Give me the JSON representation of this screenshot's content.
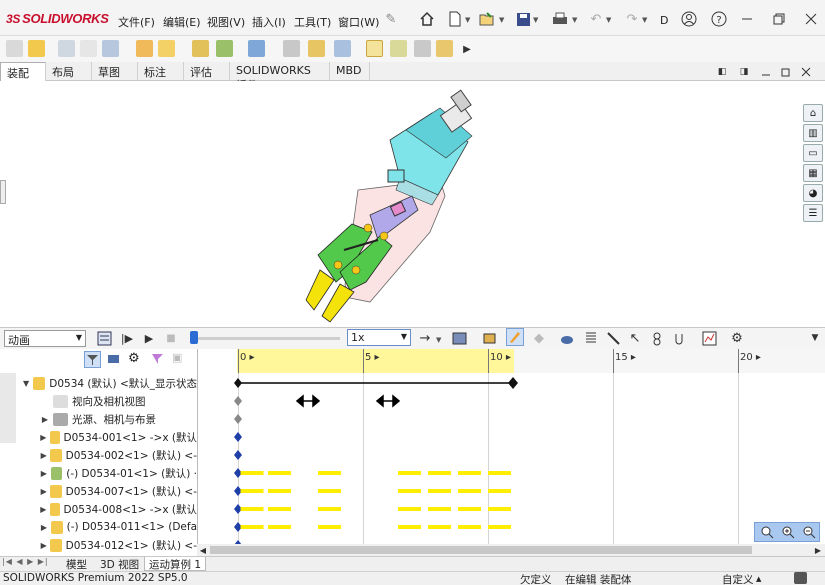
{
  "app": {
    "logo": "SOLIDWORKS",
    "logo_prefix": "3S"
  },
  "menu": [
    "文件(F)",
    "编辑(E)",
    "视图(V)",
    "插入(I)",
    "工具(T)",
    "窗口(W)"
  ],
  "right_caret": "D",
  "tabs": [
    "装配体",
    "布局",
    "草图",
    "标注",
    "评估",
    "SOLIDWORKS 插件",
    "MBD"
  ],
  "motion": {
    "study_type": "动画",
    "speed": "1x"
  },
  "ruler": [
    {
      "label": "0",
      "t": 0
    },
    {
      "label": "5",
      "t": 5
    },
    {
      "label": "10",
      "t": 10
    },
    {
      "label": "15",
      "t": 15
    },
    {
      "label": "20",
      "t": 20
    }
  ],
  "tree": [
    {
      "label": "D0534 (默认) <默认_显示状态",
      "expand": "▼",
      "level": 0,
      "icon": "asm"
    },
    {
      "label": "视向及相机视图",
      "expand": "",
      "level": 1,
      "icon": "cam"
    },
    {
      "label": "光源、相机与布景",
      "expand": "▶",
      "level": 1,
      "icon": "light"
    },
    {
      "label": "D0534-001<1> ->x (默认",
      "expand": "▶",
      "level": 1,
      "icon": "part"
    },
    {
      "label": "D0534-002<1> (默认) <-",
      "expand": "▶",
      "level": 1,
      "icon": "part"
    },
    {
      "label": "(-) D0534-01<1> (默认) ·",
      "expand": "▶",
      "level": 1,
      "icon": "part2"
    },
    {
      "label": "D0534-007<1> (默认) <-",
      "expand": "▶",
      "level": 1,
      "icon": "part"
    },
    {
      "label": "D0534-008<1> ->x (默认",
      "expand": "▶",
      "level": 1,
      "icon": "part"
    },
    {
      "label": "(-) D0534-011<1> (Defa",
      "expand": "▶",
      "level": 1,
      "icon": "part"
    },
    {
      "label": "D0534-012<1> (默认) <-",
      "expand": "▶",
      "level": 1,
      "icon": "part"
    }
  ],
  "bottom_tabs": [
    "模型",
    "3D 视图",
    "运动算例 1"
  ],
  "status": {
    "left": "SOLIDWORKS Premium 2022 SP5.0",
    "under_defined": "欠定义",
    "editing": "在编辑 装配体",
    "custom": "自定义"
  },
  "colors": {
    "accent": "#2a6cd4",
    "timeline_highlight": "#fff799",
    "yellow_bar": "#ffee00",
    "key_blue": "#1e3fa8"
  }
}
